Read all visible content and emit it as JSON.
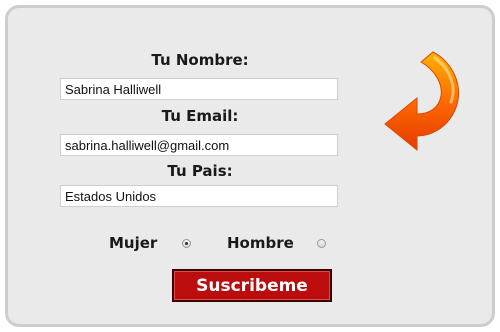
{
  "form": {
    "name_label": "Tu Nombre:",
    "name_value": "Sabrina Halliwell",
    "email_label": "Tu Email:",
    "email_value": "sabrina.halliwell@gmail.com",
    "country_label": "Tu Pais:",
    "country_value": "Estados Unidos",
    "gender_options": [
      {
        "label": "Mujer",
        "checked": true
      },
      {
        "label": "Hombre",
        "checked": false
      }
    ],
    "submit_label": "Suscribeme"
  },
  "decoration": {
    "arrow_icon": "curved-arrow-icon",
    "arrow_colors": [
      "#ffb300",
      "#ff6a00",
      "#e53a00"
    ]
  }
}
